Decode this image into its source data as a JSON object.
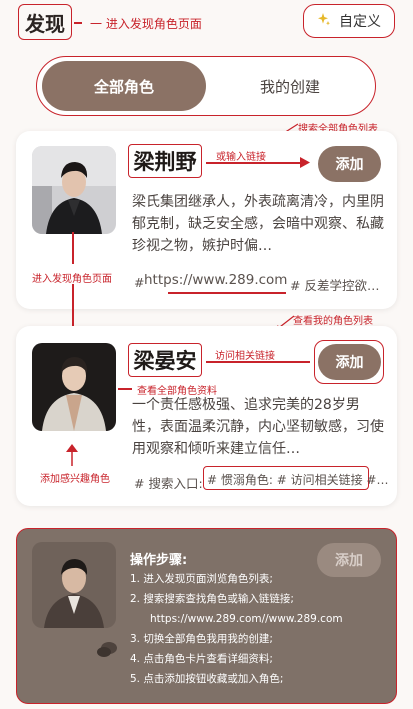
{
  "header": {
    "title": "发现",
    "title_annotation": "一 进入发现角色页面",
    "custom_button_label": "自定义"
  },
  "tabs": [
    {
      "label": "全部角色",
      "active": true
    },
    {
      "label": "我的创建",
      "active": false
    }
  ],
  "annotations": {
    "search_all": "搜索全部角色列表",
    "or_input_link": "或输入链接",
    "enter_discover": "进入发现角色页面",
    "view_my_roles": "查看我的角色列表",
    "visit_link": "访问相关链接",
    "view_all_profiles": "查看全部角色资料",
    "add_interested": "添加感兴趣角色"
  },
  "cards": [
    {
      "name": "梁荆野",
      "add_label": "添加",
      "description": "梁氏集团继承人，外表疏离清冷，内里阴郁克制，缺乏安全感，会暗中观察、私藏珍视之物，嫉护时偏…",
      "link_prefix": "# ",
      "link": "https://www.289.com",
      "tag_suffix": "# 反差学控欲…"
    },
    {
      "name": "梁晏安",
      "add_label": "添加",
      "description": "一个责任感极强、追求完美的28岁男性，表面温柔沉静，内心坚韧敏感，习使用观察和倾听来建立信任…",
      "tag_prefix": "# 搜索入口: ",
      "tags": "# 惯溺角色: # 访问相关链接 #…"
    }
  ],
  "steps_panel": {
    "title": "操作步骤:",
    "add_label": "添加",
    "steps": [
      "1. 进入发现页面浏览角色列表;",
      "2. 搜索搜索查找角色或输入链链接;",
      "   https://www.289.com//www.289.com",
      "3. 切换全部角色我用我的创建;",
      "4. 点击角色卡片查看详细资料;",
      "5. 点击添加按钮收藏或加入角色;"
    ]
  },
  "colors": {
    "accent_brown": "#8b7265",
    "annotation_red": "#c8232b",
    "panel_bg": "#7f7168"
  }
}
